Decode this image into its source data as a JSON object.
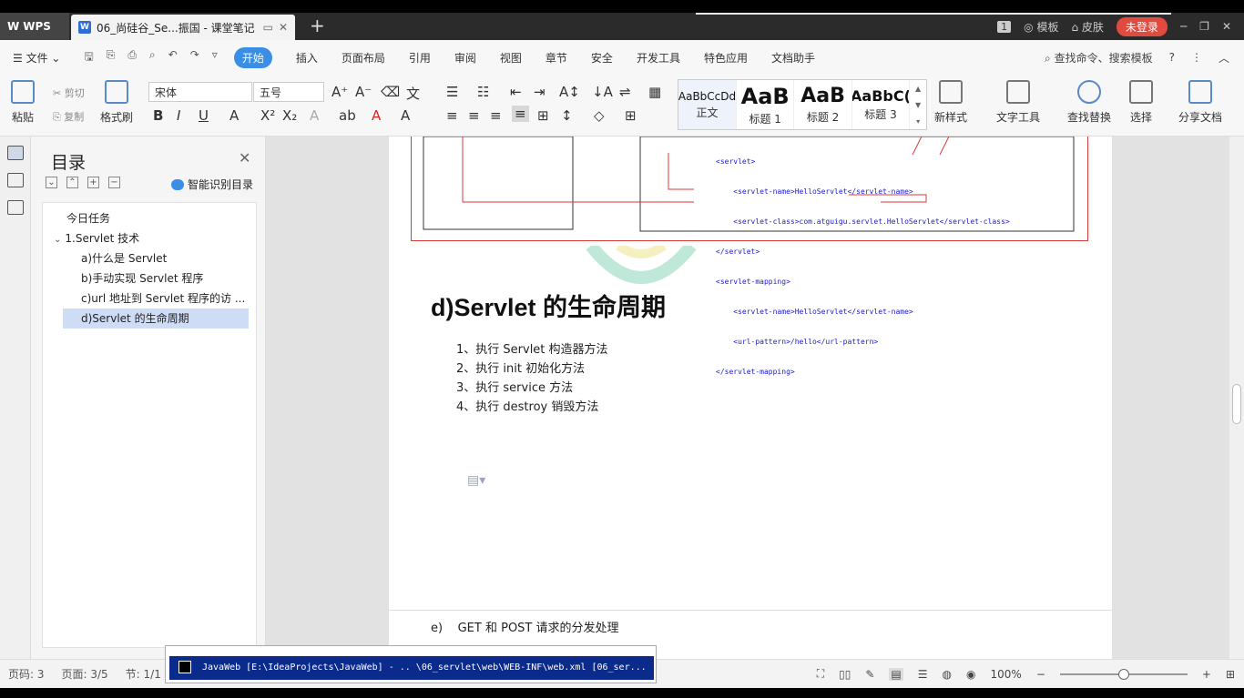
{
  "app": {
    "logo": "WPS"
  },
  "tab": {
    "title": "06_尚硅谷_Se...振国 - 课堂笔记"
  },
  "titlebar": {
    "page_badge": "1",
    "templates": "模板",
    "skin": "皮肤",
    "login": "未登录"
  },
  "menu": {
    "file": "文件",
    "items": [
      "开始",
      "插入",
      "页面布局",
      "引用",
      "审阅",
      "视图",
      "章节",
      "安全",
      "开发工具",
      "特色应用",
      "文档助手"
    ],
    "search": "查找命令、搜索模板"
  },
  "ribbon": {
    "paste": "粘贴",
    "cut": "剪切",
    "copy": "复制",
    "format_painter": "格式刷",
    "font_name": "宋体",
    "font_size": "五号",
    "styles": [
      {
        "preview": "AaBbCcDd",
        "label": "正文"
      },
      {
        "preview": "AaB",
        "label": "标题 1"
      },
      {
        "preview": "AaB",
        "label": "标题 2"
      },
      {
        "preview": "AaBbC(",
        "label": "标题 3"
      }
    ],
    "new_style": "新样式",
    "text_tools": "文字工具",
    "find_replace": "查找替换",
    "select": "选择",
    "share": "分享文档"
  },
  "nav": {
    "title": "目录",
    "smart": "智能识别目录",
    "items": [
      {
        "label": "今日任务",
        "level": 0
      },
      {
        "label": "1.Servlet 技术",
        "level": 1
      },
      {
        "label": "a)什么是 Servlet",
        "level": 2
      },
      {
        "label": "b)手动实现 Servlet 程序",
        "level": 2
      },
      {
        "label": "c)url 地址到 Servlet 程序的访 ...",
        "level": 2
      },
      {
        "label": "d)Servlet 的生命周期",
        "level": 2
      }
    ]
  },
  "doc": {
    "code_lines": [
      "<servlet>",
      "    <servlet-name>HelloServlet</servlet-name>",
      "    <servlet-class>com.atguigu.servlet.HelloServlet</servlet-class>",
      "</servlet>",
      "<servlet-mapping>",
      "    <servlet-name>HelloServlet</servlet-name>",
      "    <url-pattern>/hello</url-pattern>",
      "</servlet-mapping>"
    ],
    "heading": "d)Servlet 的生命周期",
    "steps": [
      "1、执行 Servlet 构造器方法",
      "2、执行 init 初始化方法",
      "3、执行 service 方法",
      "4、执行 destroy 销毁方法"
    ],
    "next_heading_num": "e)",
    "next_heading_text": "GET 和 POST 请求的分发处理"
  },
  "status": {
    "page_no": "页码: 3",
    "page": "页面: 3/5",
    "section": "节: 1/1",
    "zoom": "100%"
  },
  "tooltip": {
    "text": "JavaWeb [E:\\IdeaProjects\\JavaWeb] - .. \\06_servlet\\web\\WEB-INF\\web.xml [06_ser..."
  }
}
